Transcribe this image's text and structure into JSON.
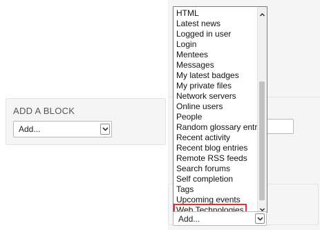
{
  "add_block_left": {
    "title": "ADD A BLOCK",
    "select": {
      "selected": "Add...",
      "arrow_icon": "chevron-down-icon"
    }
  },
  "add_block_right": {
    "dropdown": {
      "options": [
        "HTML",
        "Latest news",
        "Logged in user",
        "Login",
        "Mentees",
        "Messages",
        "My latest badges",
        "My private files",
        "Network servers",
        "Online users",
        "People",
        "Random glossary entry",
        "Recent activity",
        "Recent blog entries",
        "Remote RSS feeds",
        "Search forums",
        "Self completion",
        "Tags",
        "Upcoming events",
        "Web Technologies"
      ],
      "highlighted_option": "Web Technologies",
      "highlight_color": "#e03030",
      "scroll_up_icon": "caret-up-icon",
      "scroll_down_icon": "caret-down-icon"
    },
    "select": {
      "selected": "Add...",
      "arrow_icon": "chevron-down-icon"
    }
  }
}
